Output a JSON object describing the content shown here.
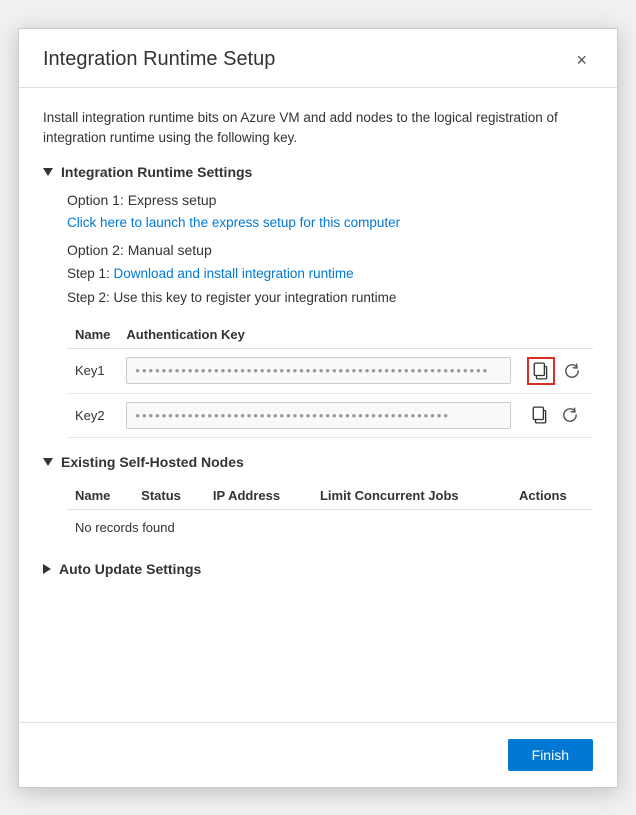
{
  "modal": {
    "title": "Integration Runtime Setup",
    "close_label": "×",
    "intro_text": "Install integration runtime bits on Azure VM and add nodes to the logical registration of integration runtime using the following key.",
    "finish_label": "Finish"
  },
  "integration_runtime_settings": {
    "section_title": "Integration Runtime Settings",
    "option1_label": "Option 1: Express setup",
    "express_link": "Click here to launch the express setup for this computer",
    "option2_label": "Option 2: Manual setup",
    "step1_prefix": "Step 1: ",
    "step1_link": "Download and install integration runtime",
    "step2_text": "Step 2: Use this key to register your integration runtime",
    "table": {
      "col_name": "Name",
      "col_key": "Authentication Key",
      "rows": [
        {
          "name": "Key1",
          "value": "••••••••••••••••••••••••••••••••••••••••••••••••••••••"
        },
        {
          "name": "Key2",
          "value": "••••••••••••••••••••••••••••••••••••••••••••••••"
        }
      ]
    }
  },
  "existing_nodes": {
    "section_title": "Existing Self-Hosted Nodes",
    "col_name": "Name",
    "col_status": "Status",
    "col_ip": "IP Address",
    "col_concurrent": "Limit Concurrent Jobs",
    "col_actions": "Actions",
    "no_records": "No records found"
  },
  "auto_update": {
    "section_title": "Auto Update Settings"
  }
}
